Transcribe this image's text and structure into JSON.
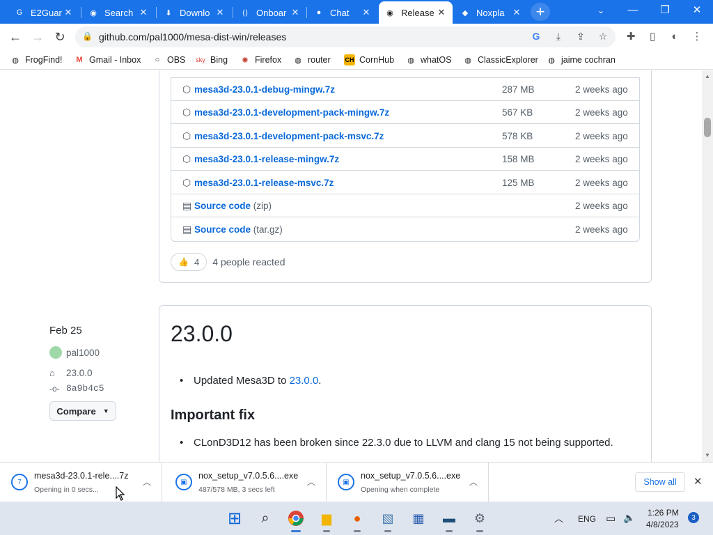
{
  "browser": {
    "tabs": [
      {
        "title": "E2Guar",
        "icon": "g-icon"
      },
      {
        "title": "Search",
        "icon": "github-icon"
      },
      {
        "title": "Downlo",
        "icon": "download-icon"
      },
      {
        "title": "Onboar",
        "icon": "puzzle-icon"
      },
      {
        "title": "Chat",
        "icon": "chat-icon"
      },
      {
        "title": "Release",
        "icon": "github-icon"
      },
      {
        "title": "Noxpla",
        "icon": "nox-icon"
      }
    ],
    "url": "github.com/pal1000/mesa-dist-win/releases",
    "bookmarks": [
      {
        "label": "FrogFind!"
      },
      {
        "label": "Gmail - Inbox"
      },
      {
        "label": "OBS"
      },
      {
        "label": "Bing"
      },
      {
        "label": "Firefox"
      },
      {
        "label": "router"
      },
      {
        "label": "CornHub"
      },
      {
        "label": "whatOS"
      },
      {
        "label": "ClassicExplorer"
      },
      {
        "label": "jaime cochran"
      }
    ]
  },
  "assets": [
    {
      "name": "mesa3d-23.0.1-debug-mingw.7z",
      "suffix": "",
      "size": "287 MB",
      "date": "2 weeks ago"
    },
    {
      "name": "mesa3d-23.0.1-development-pack-mingw.7z",
      "suffix": "",
      "size": "567 KB",
      "date": "2 weeks ago"
    },
    {
      "name": "mesa3d-23.0.1-development-pack-msvc.7z",
      "suffix": "",
      "size": "578 KB",
      "date": "2 weeks ago"
    },
    {
      "name": "mesa3d-23.0.1-release-mingw.7z",
      "suffix": "",
      "size": "158 MB",
      "date": "2 weeks ago"
    },
    {
      "name": "mesa3d-23.0.1-release-msvc.7z",
      "suffix": "",
      "size": "125 MB",
      "date": "2 weeks ago"
    },
    {
      "name": "Source code",
      "suffix": " (zip)",
      "size": "",
      "date": "2 weeks ago"
    },
    {
      "name": "Source code",
      "suffix": " (tar.gz)",
      "size": "",
      "date": "2 weeks ago"
    }
  ],
  "reaction": {
    "count": "4",
    "text": "4 people reacted"
  },
  "release": {
    "date": "Feb 25",
    "author": "pal1000",
    "tag": "23.0.0",
    "commit": "8a9b4c5",
    "compare": "Compare",
    "title": "23.0.0",
    "bullet1_pre": "Updated Mesa3D to ",
    "bullet1_link": "23.0.0",
    "bullet1_post": ".",
    "heading": "Important fix",
    "bullet2": "CLonD3D12 has been broken since 22.3.0 due to LLVM and clang 15 not being supported."
  },
  "downloads": [
    {
      "name": "mesa3d-23.0.1-rele....7z",
      "status": "Opening in 0 secs..."
    },
    {
      "name": "nox_setup_v7.0.5.6....exe",
      "status": "487/578 MB, 3 secs left"
    },
    {
      "name": "nox_setup_v7.0.5.6....exe",
      "status": "Opening when complete"
    }
  ],
  "show_all": "Show all",
  "taskbar": {
    "lang": "ENG",
    "time": "1:26 PM",
    "date": "4/8/2023",
    "notifications": "3"
  },
  "colors": {
    "accent": "#1a73e8",
    "link": "#0969da"
  }
}
